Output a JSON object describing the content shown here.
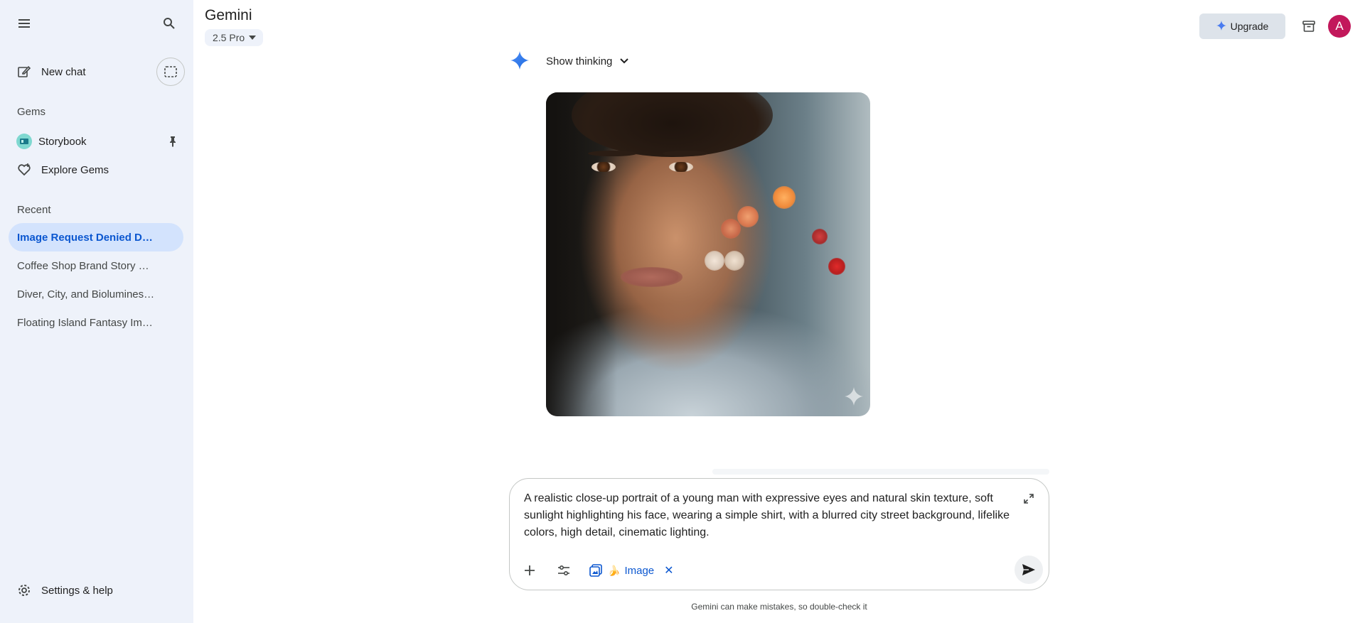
{
  "sidebar": {
    "menu_icon": "hamburger-menu-icon",
    "search_icon": "search-icon",
    "new_chat_label": "New chat",
    "gems_title": "Gems",
    "gems": [
      {
        "label": "Storybook",
        "icon": "book-icon",
        "pinned": true
      }
    ],
    "explore_label": "Explore Gems",
    "recent_title": "Recent",
    "recent": [
      {
        "label": "Image Request Denied Due...",
        "active": true
      },
      {
        "label": "Coffee Shop Brand Story Vi...",
        "active": false
      },
      {
        "label": "Diver, City, and Bioluminesc...",
        "active": false
      },
      {
        "label": "Floating Island Fantasy Ima...",
        "active": false
      }
    ],
    "settings_label": "Settings & help"
  },
  "header": {
    "title": "Gemini",
    "model": "2.5 Pro",
    "upgrade_label": "Upgrade",
    "avatar_letter": "A"
  },
  "response": {
    "show_thinking_label": "Show thinking"
  },
  "composer": {
    "prompt": "A realistic close-up portrait of a young man with expressive eyes and natural skin texture, soft sunlight highlighting his face, wearing a simple shirt, with a blurred city street background, lifelike colors, high detail, cinematic lighting.",
    "chip_emoji": "🍌",
    "chip_label": "Image",
    "chip_close": "✕"
  },
  "disclaimer": "Gemini can make mistakes, so double-check it",
  "colors": {
    "sidebar_bg": "#eef2fa",
    "active_item_bg": "#d3e3fd",
    "accent_blue": "#0b57d0",
    "avatar_bg": "#c2185b"
  }
}
